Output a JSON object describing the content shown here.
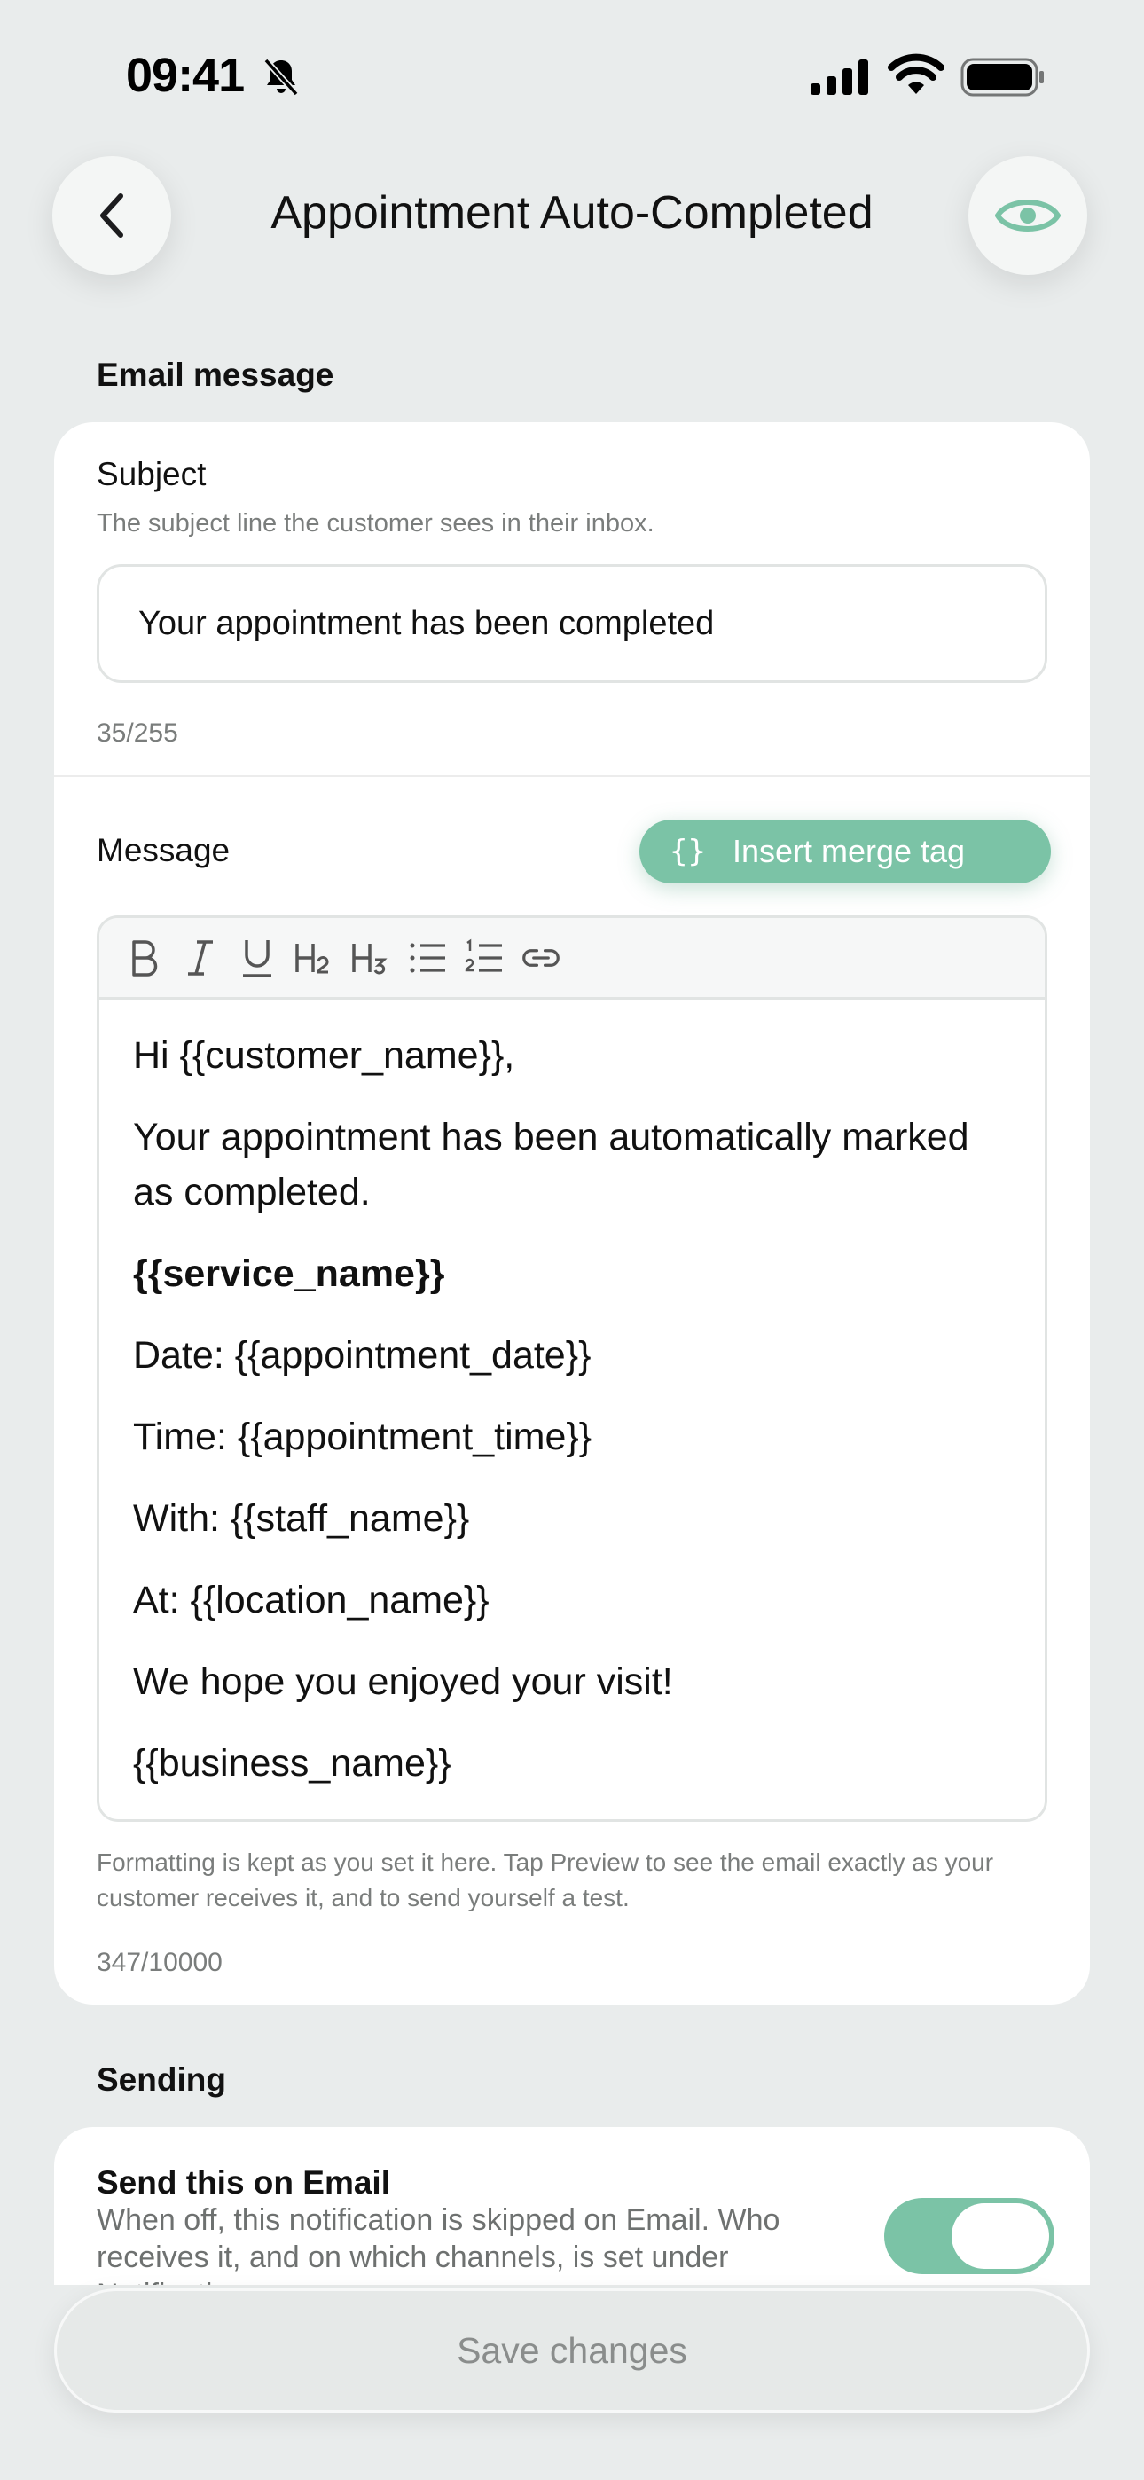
{
  "status_bar": {
    "time": "09:41"
  },
  "header": {
    "title": "Appointment Auto-Completed"
  },
  "email_section": {
    "heading": "Email message",
    "subject": {
      "label": "Subject",
      "hint": "The subject line the customer sees in their inbox.",
      "value": "Your appointment has been completed",
      "counter": "35/255"
    },
    "message": {
      "label": "Message",
      "merge_button": "Insert merge tag",
      "toolbar": [
        "bold",
        "italic",
        "underline",
        "heading-2",
        "heading-3",
        "bullet-list",
        "numbered-list",
        "link"
      ],
      "body": {
        "greeting": "Hi {{customer_name}},",
        "intro": "Your appointment has been automatically marked as completed.",
        "service": "{{service_name}}",
        "date": "Date: {{appointment_date}}",
        "time": "Time: {{appointment_time}}",
        "staff": "With: {{staff_name}}",
        "location": "At: {{location_name}}",
        "closing": "We hope you enjoyed your visit!",
        "signature": "{{business_name}}"
      },
      "note": "Formatting is kept as you set it here. Tap Preview to see the email exactly as your customer receives it, and to send yourself a test.",
      "counter": "347/10000"
    }
  },
  "sending_section": {
    "heading": "Sending",
    "email_toggle": {
      "title": "Send this on Email",
      "description": "When off, this notification is skipped on Email. Who receives it, and on which channels, is set under Notifications.",
      "enabled": true
    }
  },
  "footer": {
    "save_label": "Save changes"
  },
  "colors": {
    "accent": "#7bc3a6",
    "background": "#e9ecec",
    "card": "#ffffff"
  }
}
